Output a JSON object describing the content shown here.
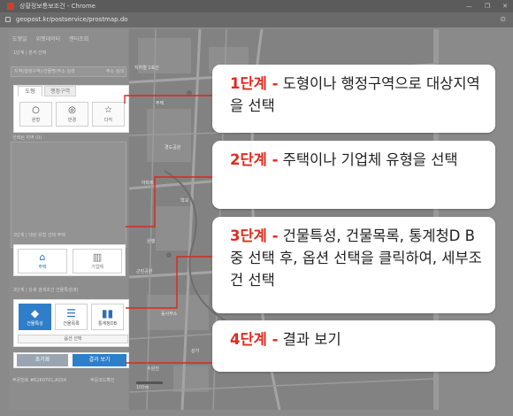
{
  "browser": {
    "window_title": "상황정보통보조건 - Chrome",
    "url": "geopost.kr/postservice/prostmap.do",
    "window_buttons": [
      "—",
      "❐",
      "✕"
    ]
  },
  "panel": {
    "top_tabs": [
      "도형일",
      "위젯데이터",
      "엔터조회"
    ],
    "section1_label": "1단계 | 분석 선택",
    "region_row": "지역(행정구역)/건물명/주소 검색",
    "region_search": "주소 검색",
    "shape_tabs": [
      "도형",
      "행정구역"
    ],
    "shape_buttons": [
      {
        "icon": "circle-icon",
        "glyph": "○",
        "label": "원형"
      },
      {
        "icon": "radius-icon",
        "glyph": "◎",
        "label": "반경"
      },
      {
        "icon": "star-icon",
        "glyph": "☆",
        "label": "다각"
      }
    ],
    "selected_area_label": "선택된 지역 (0)",
    "section2_label": "2단계 | 대상 유형 선택 주택",
    "type_buttons": [
      {
        "icon": "house-icon",
        "glyph": "⌂",
        "label": "주택"
      },
      {
        "icon": "building-icon",
        "glyph": "▥",
        "label": "기업체"
      }
    ],
    "section3_label": "3단계 | 상세 검색조건 건물특성(8)",
    "select_buttons": [
      {
        "icon": "cube-icon",
        "glyph": "◆",
        "label": "건물특성"
      },
      {
        "icon": "list-icon",
        "glyph": "☰",
        "label": "건물목록"
      },
      {
        "icon": "bar-chart-icon",
        "glyph": "▮▮",
        "label": "통계청DB"
      }
    ],
    "option_button": "옵션 선택",
    "reset_button": "초기화",
    "result_button": "결과 보기",
    "footer_left": "주문번호 #6260701,A034",
    "footer_right": "주문코드확인"
  },
  "map": {
    "scale_label": "100m",
    "labels": [
      "지하철 1호선",
      "주택",
      "경도공원",
      "아파트",
      "학교",
      "은행",
      "근린공원",
      "동사무소",
      "상가",
      "수원천"
    ]
  },
  "callouts": [
    {
      "step": "1단계 -",
      "text": " 도형이나 행정구역으로 대상지역을 선택"
    },
    {
      "step": "2단계 -",
      "text": " 주택이나 기업체 유형을 선택"
    },
    {
      "step": "3단계 -",
      "text": " 건물특성, 건물목록, 통계청D B 중 선택 후, 옵션 선택을 클릭하여, 세부조건 선택"
    },
    {
      "step": "4단계 -",
      "text": " 결과 보기"
    }
  ],
  "colors": {
    "step_red": "#e02b1c",
    "accent_blue": "#2f7ec9",
    "connector_red": "#d62a1e"
  }
}
